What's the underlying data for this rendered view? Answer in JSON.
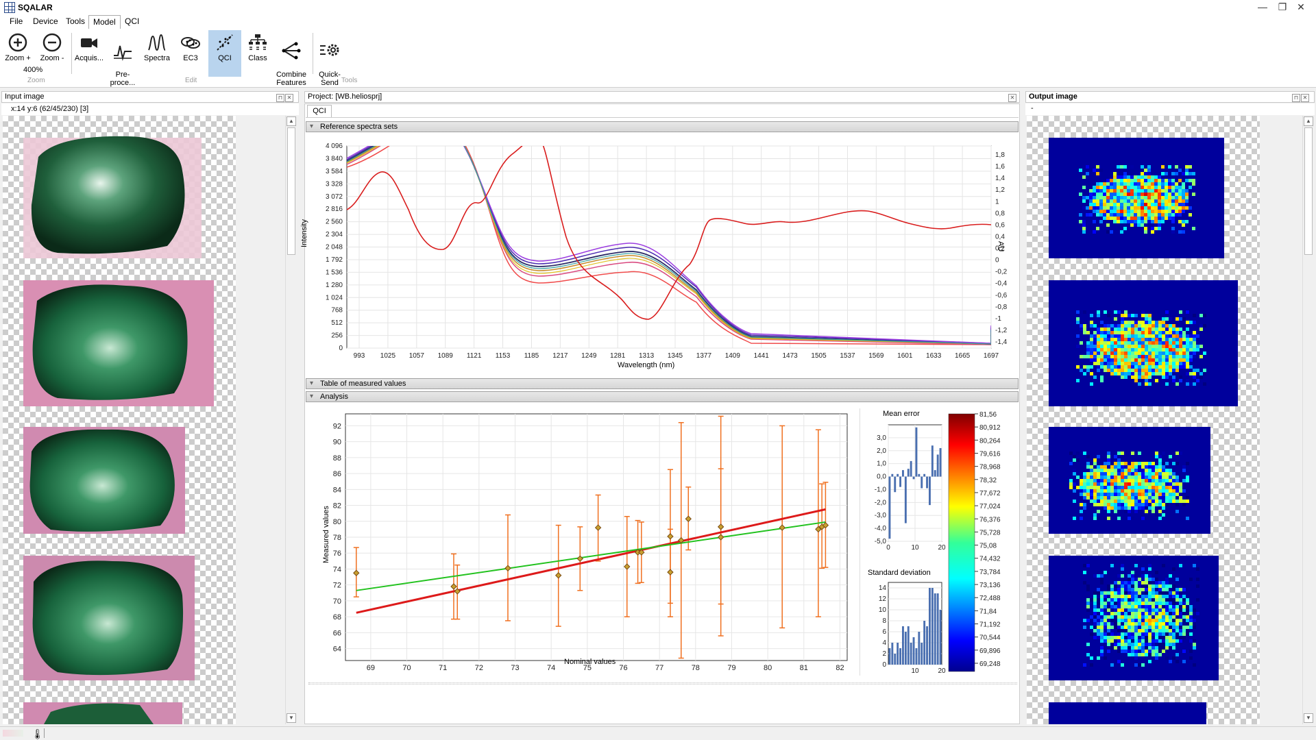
{
  "app": {
    "title": "SQALAR"
  },
  "window": {
    "minimize": "—",
    "restore": "❐",
    "close": "✕"
  },
  "menu": [
    "File",
    "Device",
    "Tools",
    "Model",
    "QCI"
  ],
  "ribbon": {
    "buttons": [
      {
        "id": "zoom-in",
        "label": "Zoom +",
        "icon": "zoom-in-icon"
      },
      {
        "id": "zoom-out",
        "label": "Zoom -",
        "icon": "zoom-out-icon"
      },
      {
        "id": "acquisition",
        "label": "Acquis...",
        "icon": "camera-icon"
      },
      {
        "id": "preprocessing",
        "label": "Pre-\nproce...",
        "icon": "signal-icon"
      },
      {
        "id": "spectra",
        "label": "Spectra",
        "icon": "spectra-icon"
      },
      {
        "id": "ec3",
        "label": "EC3",
        "icon": "cluster-icon"
      },
      {
        "id": "qci",
        "label": "QCI",
        "icon": "qci-icon"
      },
      {
        "id": "class",
        "label": "Class",
        "icon": "tree-icon"
      },
      {
        "id": "combine-features",
        "label": "Combine\nFeatures",
        "icon": "combine-icon"
      },
      {
        "id": "quick-send",
        "label": "Quick-\nSend",
        "icon": "gear-list-icon"
      }
    ],
    "zoom_level": "400%",
    "groups": [
      "Zoom",
      "Edit",
      "Tools"
    ]
  },
  "input_panel": {
    "title": "Input image",
    "coords": "x:14 y:6 (62/45/230) [3]"
  },
  "project_panel": {
    "title": "Project: [WB.heliosprj]",
    "tab": "QCI",
    "sections": [
      "Reference spectra sets",
      "Table of measured values",
      "Analysis"
    ]
  },
  "output_panel": {
    "title": "Output image",
    "sub": "-"
  },
  "spectra_chart": {
    "xlabel": "Wavelength (nm)",
    "ylabel": "Intensity",
    "y2label": "AU",
    "xticks": [
      "993",
      "1025",
      "1057",
      "1089",
      "1121",
      "1153",
      "1185",
      "1217",
      "1249",
      "1281",
      "1313",
      "1345",
      "1377",
      "1409",
      "1441",
      "1473",
      "1505",
      "1537",
      "1569",
      "1601",
      "1633",
      "1665",
      "1697"
    ],
    "yticks": [
      "0",
      "256",
      "512",
      "768",
      "1 024",
      "1 280",
      "1 536",
      "1 792",
      "2 048",
      "2 304",
      "2 560",
      "2 816",
      "3 072",
      "3 328",
      "3 584",
      "3 840",
      "4 096"
    ],
    "y2ticks": [
      "-1,4",
      "-1,2",
      "-1",
      "-0,8",
      "-0,6",
      "-0,4",
      "-0,2",
      "0",
      "0,2",
      "0,4",
      "0,6",
      "0,8",
      "1",
      "1,2",
      "1,4",
      "1,6",
      "1,8"
    ]
  },
  "chart_data": [
    {
      "type": "scatter",
      "title": "",
      "xlabel": "Nominal values",
      "ylabel": "Measured values",
      "xlim": [
        68.3,
        82.2
      ],
      "ylim": [
        62.5,
        93.5
      ],
      "xticks": [
        "69",
        "70",
        "71",
        "72",
        "73",
        "74",
        "75",
        "76",
        "77",
        "78",
        "79",
        "80",
        "81",
        "82"
      ],
      "yticks": [
        "64",
        "66",
        "68",
        "70",
        "72",
        "74",
        "76",
        "78",
        "80",
        "82",
        "84",
        "86",
        "88",
        "90",
        "92"
      ],
      "grid": true,
      "points": [
        {
          "x": 68.6,
          "y": 73.5,
          "lo": 70.5,
          "hi": 76.7
        },
        {
          "x": 71.3,
          "y": 71.8,
          "lo": 67.7,
          "hi": 75.9
        },
        {
          "x": 71.4,
          "y": 71.2,
          "lo": 67.7,
          "hi": 74.5
        },
        {
          "x": 72.8,
          "y": 74.1,
          "lo": 67.5,
          "hi": 80.8
        },
        {
          "x": 74.2,
          "y": 73.2,
          "lo": 66.8,
          "hi": 79.5
        },
        {
          "x": 74.8,
          "y": 75.3,
          "lo": 71.3,
          "hi": 79.3
        },
        {
          "x": 75.3,
          "y": 79.2,
          "lo": 75.0,
          "hi": 83.3
        },
        {
          "x": 76.1,
          "y": 74.3,
          "lo": 68.0,
          "hi": 80.6
        },
        {
          "x": 76.4,
          "y": 76.1,
          "lo": 72.2,
          "hi": 80.1
        },
        {
          "x": 76.5,
          "y": 76.1,
          "lo": 72.3,
          "hi": 79.9
        },
        {
          "x": 77.3,
          "y": 73.6,
          "lo": 68.0,
          "hi": 79.0
        },
        {
          "x": 77.3,
          "y": 78.1,
          "lo": 69.7,
          "hi": 86.5
        },
        {
          "x": 77.6,
          "y": 77.6,
          "lo": 62.8,
          "hi": 92.4
        },
        {
          "x": 77.8,
          "y": 80.3,
          "lo": 76.4,
          "hi": 84.3
        },
        {
          "x": 78.7,
          "y": 78.0,
          "lo": 65.6,
          "hi": 93.2
        },
        {
          "x": 78.7,
          "y": 79.3,
          "lo": 69.6,
          "hi": 86.6
        },
        {
          "x": 80.4,
          "y": 79.2,
          "lo": 66.6,
          "hi": 92.0
        },
        {
          "x": 81.4,
          "y": 79.0,
          "lo": 68.0,
          "hi": 91.5
        },
        {
          "x": 81.5,
          "y": 79.3,
          "lo": 74.1,
          "hi": 84.7
        },
        {
          "x": 81.6,
          "y": 79.5,
          "lo": 74.2,
          "hi": 84.9
        }
      ],
      "series": [
        {
          "kind": "line",
          "x": [
            68.6,
            81.6
          ],
          "y": [
            68.5,
            81.5
          ],
          "color": "#dd1a1a"
        },
        {
          "kind": "line",
          "x": [
            68.6,
            81.6
          ],
          "y": [
            71.3,
            79.9
          ],
          "color": "#22c21e"
        }
      ]
    },
    {
      "type": "bar",
      "title": "Mean error",
      "xlim": [
        0,
        20
      ],
      "ylim": [
        -5,
        4
      ],
      "xticks": [
        "0",
        "10",
        "20"
      ],
      "yticks": [
        "3,0",
        "2,0",
        "1,0",
        "0,0",
        "-1,0",
        "-2,0",
        "-3,0",
        "-4,0",
        "-5,0"
      ],
      "values": [
        -4.8,
        0.2,
        -1.2,
        0.2,
        -0.8,
        0.5,
        -3.6,
        0.6,
        1.2,
        -0.2,
        3.8,
        0.2,
        -0.9,
        0.2,
        -0.9,
        -2.2,
        2.4,
        0.5,
        1.7,
        2.2
      ]
    },
    {
      "type": "bar",
      "title": "Standard deviation",
      "xlim": [
        0,
        20
      ],
      "ylim": [
        0,
        15
      ],
      "xticks": [
        "10",
        "20"
      ],
      "yticks": [
        "14",
        "12",
        "10",
        "8",
        "6",
        "4",
        "2",
        "0"
      ],
      "values": [
        3,
        4,
        2,
        4,
        3,
        7,
        6,
        7,
        4,
        5,
        3,
        6,
        4,
        8,
        7,
        14,
        14,
        13,
        13,
        10
      ]
    },
    {
      "type": "heatmap",
      "title": "colour scale",
      "scale": [
        "81,56",
        "80,912",
        "80,264",
        "79,616",
        "78,968",
        "78,32",
        "77,672",
        "77,024",
        "76,376",
        "75,728",
        "75,08",
        "74,432",
        "73,784",
        "73,136",
        "72,488",
        "71,84",
        "71,192",
        "70,544",
        "69,896",
        "69,248"
      ]
    }
  ]
}
